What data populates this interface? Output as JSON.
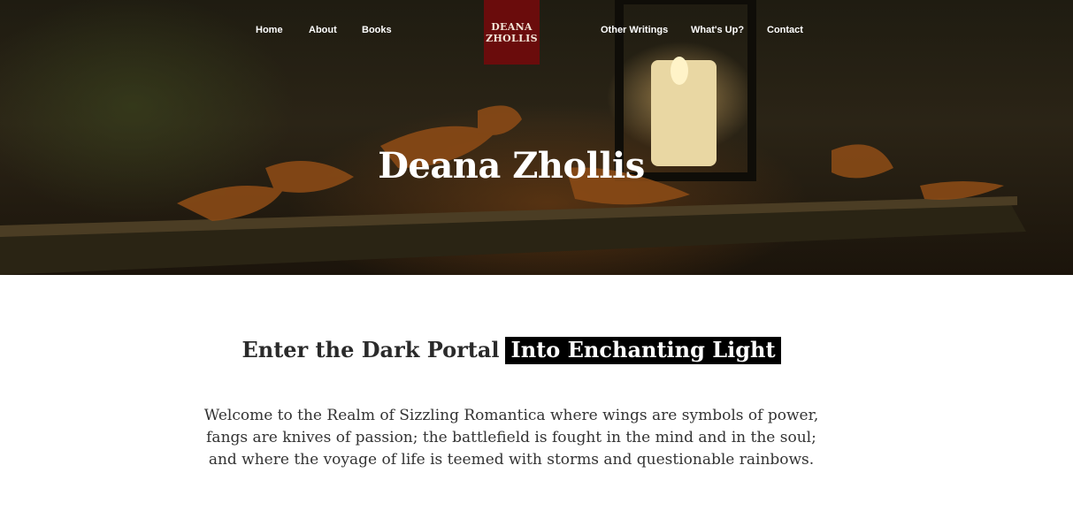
{
  "nav": {
    "home": "Home",
    "about": "About",
    "books": "Books",
    "other_writings": "Other Writings",
    "whats_up": "What's Up?",
    "contact": "Contact"
  },
  "logo": {
    "line1": "DEANA",
    "line2": "ZHOLLIS"
  },
  "hero": {
    "title": "Deana Zhollis"
  },
  "headline": {
    "part1": "Enter the Dark Portal",
    "highlight": "Into Enchanting Light"
  },
  "intro": {
    "line1": "Welcome to the Realm of Sizzling Romantica where wings are symbols of power,",
    "line2": "fangs are knives of passion; the battlefield is fought in the mind and in the soul;",
    "line3": "and where the voyage of life is teemed with storms and questionable rainbows."
  },
  "colors": {
    "logo_bg": "#6a0c0c",
    "highlight_bg": "#000000",
    "text": "#333333"
  }
}
